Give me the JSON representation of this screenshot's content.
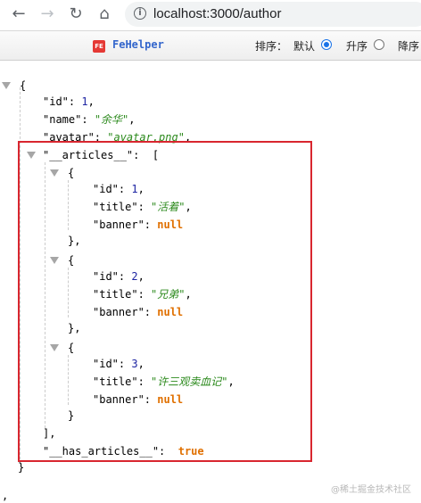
{
  "browser": {
    "url": "localhost:3000/author"
  },
  "fehelper": {
    "name": "FeHelper",
    "logo_text": "FE",
    "sort_label": "排序：",
    "options": [
      "默认",
      "升序",
      "降序"
    ],
    "selected": "默认"
  },
  "json": {
    "open_brace": "{",
    "id_key": "\"id\"",
    "id_value": "1",
    "name_key": "\"name\"",
    "name_value": "\"余华\"",
    "avatar_key": "\"avatar\"",
    "avatar_value": "\"avatar.png\"",
    "articles_key": "\"__articles__\"",
    "articles": [
      {
        "id_key": "\"id\"",
        "id": "1",
        "title_key": "\"title\"",
        "title": "\"活着\"",
        "banner_key": "\"banner\"",
        "banner": "null"
      },
      {
        "id_key": "\"id\"",
        "id": "2",
        "title_key": "\"title\"",
        "title": "\"兄弟\"",
        "banner_key": "\"banner\"",
        "banner": "null"
      },
      {
        "id_key": "\"id\"",
        "id": "3",
        "title_key": "\"title\"",
        "title": "\"许三观卖血记\"",
        "banner_key": "\"banner\"",
        "banner": "null"
      }
    ],
    "has_articles_key": "\"__has_articles__\"",
    "has_articles_value": "true",
    "close_brace": "}"
  },
  "watermark": "@稀土掘金技术社区",
  "colors": {
    "highlight_border": "#d9262f",
    "number": "#1f26a3",
    "string": "#2c8a1d",
    "keyword": "#e07000"
  }
}
